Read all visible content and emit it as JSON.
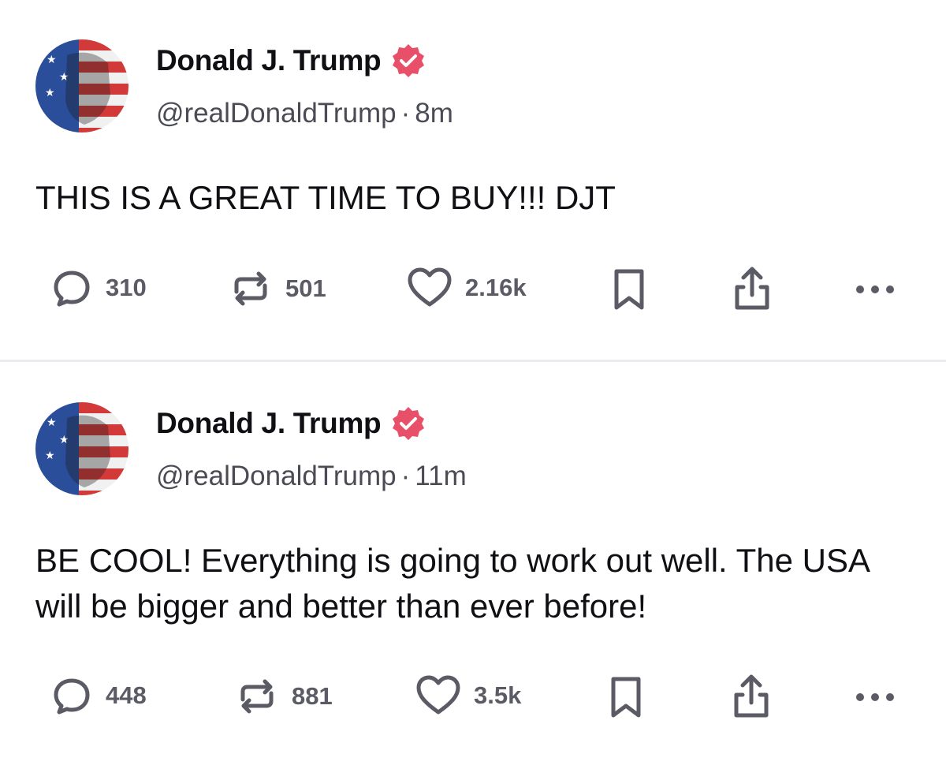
{
  "posts": [
    {
      "author": {
        "name": "Donald J. Trump",
        "handle": "@realDonaldTrump",
        "time": "8m",
        "verified": true
      },
      "text": "THIS IS A GREAT TIME TO BUY!!! DJT",
      "stats": {
        "replies": "310",
        "reposts": "501",
        "likes": "2.16k"
      }
    },
    {
      "author": {
        "name": "Donald J. Trump",
        "handle": "@realDonaldTrump",
        "time": "11m",
        "verified": true
      },
      "text": "BE COOL! Everything is going to work out well. The USA will be bigger and better than ever before!",
      "stats": {
        "replies": "448",
        "reposts": "881",
        "likes": "3.5k"
      }
    }
  ],
  "separator": "·",
  "colors": {
    "verified": "#e8506a",
    "icon": "#5b5b66",
    "text": "#0f0f14",
    "handle": "#4b4b55"
  },
  "icons": [
    "reply-icon",
    "repost-icon",
    "like-icon",
    "bookmark-icon",
    "share-icon",
    "more-icon"
  ]
}
